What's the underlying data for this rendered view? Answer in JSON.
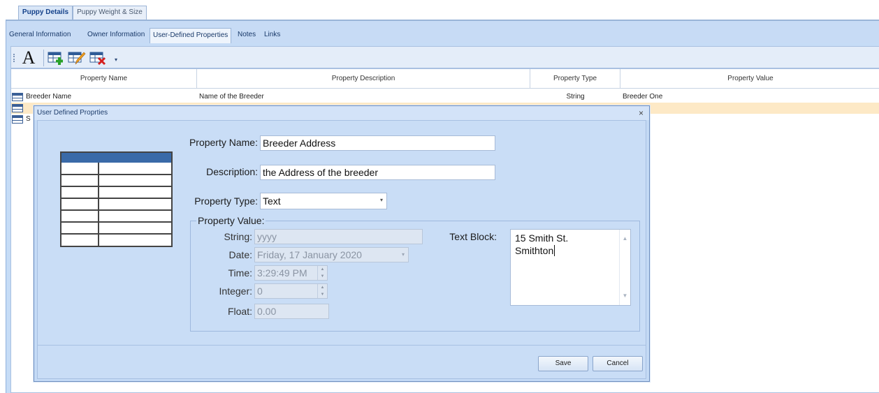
{
  "doc_tabs": [
    "Puppy Details",
    "Puppy Weight & Size"
  ],
  "sub_tabs": [
    "General Information",
    "Owner Information",
    "User-Defined Properties",
    "Notes",
    "Links"
  ],
  "toolbar": {
    "font_glyph": "A",
    "buttons": [
      "add-property-icon",
      "edit-property-icon",
      "delete-property-icon"
    ]
  },
  "grid": {
    "columns": [
      "Property Name",
      "Property Description",
      "Property Type",
      "Property Value"
    ],
    "rows": [
      {
        "name": "Breeder Name",
        "description": "Name of the Breeder",
        "type": "String",
        "value": "Breeder One"
      },
      {
        "name": "",
        "description": "",
        "type": "",
        "value": ""
      },
      {
        "name": "S",
        "description": "",
        "type": "",
        "value": ""
      }
    ]
  },
  "dialog": {
    "title": "User Defined Proprties",
    "close_glyph": "×",
    "property_name_label": "Property Name:",
    "property_name_value": "Breeder Address",
    "description_label": "Description:",
    "description_value": "the Address of the breeder",
    "property_type_label": "Property Type:",
    "property_type_value": "Text",
    "property_value_group": "Property Value:",
    "string_label": "String:",
    "string_value": "yyyy",
    "date_label": "Date:",
    "date_value": "Friday, 17 January 2020",
    "time_label": "Time:",
    "time_value": "3:29:49 PM",
    "integer_label": "Integer:",
    "integer_value": "0",
    "float_label": "Float:",
    "float_value": "0.00",
    "text_block_label": "Text Block:",
    "text_block_lines": [
      "15 Smith St.",
      "Smithton"
    ],
    "save_label": "Save",
    "cancel_label": "Cancel"
  },
  "colors": {
    "panel": "#c6dcf6",
    "selected_row": "#fde9c6",
    "table_header": "#3a6aa8"
  }
}
